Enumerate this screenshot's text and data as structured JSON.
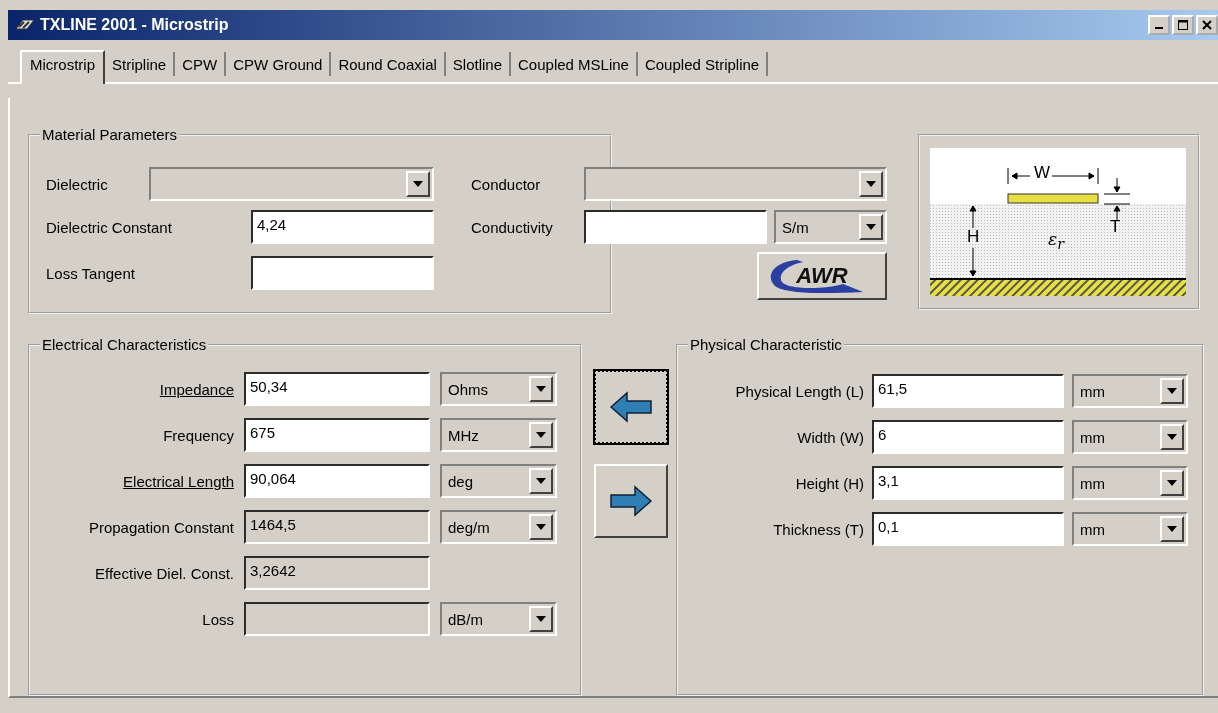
{
  "window": {
    "title": "TXLINE 2001 - Microstrip"
  },
  "tabs": [
    {
      "label": "Microstrip",
      "selected": true
    },
    {
      "label": "Stripline",
      "selected": false
    },
    {
      "label": "CPW",
      "selected": false
    },
    {
      "label": "CPW Ground",
      "selected": false
    },
    {
      "label": "Round Coaxial",
      "selected": false
    },
    {
      "label": "Slotline",
      "selected": false
    },
    {
      "label": "Coupled MSLine",
      "selected": false
    },
    {
      "label": "Coupled Stripline",
      "selected": false
    }
  ],
  "material": {
    "title": "Material Parameters",
    "dielectric": {
      "label": "Dielectric"
    },
    "dielectric_constant": {
      "label": "Dielectric Constant",
      "value": "4,24"
    },
    "loss_tangent": {
      "label": "Loss Tangent"
    },
    "conductor": {
      "label": "Conductor"
    },
    "conductivity": {
      "label": "Conductivity",
      "unit": "S/m"
    },
    "logo_button": "AWR"
  },
  "diagram": {
    "width": "W",
    "height": "H",
    "thickness": "T",
    "permittivity": "ε$_{r}$"
  },
  "electrical": {
    "title": "Electrical Characteristics",
    "rows": [
      {
        "label": "Impedance",
        "underlined": true,
        "editable": true,
        "value": "50,34",
        "unit": "Ohms"
      },
      {
        "label": "Frequency",
        "underlined": false,
        "editable": true,
        "value": "675",
        "unit": "MHz"
      },
      {
        "label": "Electrical Length",
        "underlined": true,
        "editable": true,
        "value": "90,064",
        "unit": "deg"
      },
      {
        "label": "Propagation Constant",
        "underlined": false,
        "editable": false,
        "value": "1464,5",
        "unit": "deg/m"
      },
      {
        "label": "Effective Diel. Const.",
        "underlined": false,
        "editable": false,
        "value": "3,2642"
      },
      {
        "label": "Loss",
        "underlined": false,
        "editable": false,
        "unit": "dB/m"
      }
    ]
  },
  "direction_buttons": [
    {
      "kind": "left",
      "selected": true
    },
    {
      "kind": "right",
      "selected": false
    }
  ],
  "physical": {
    "title": "Physical Characteristic",
    "rows": [
      {
        "label": "Physical Length (L)",
        "underlined": false,
        "editable": true,
        "value": "61,5",
        "unit": "mm"
      },
      {
        "label": "Width (W)",
        "underlined": false,
        "editable": true,
        "value": "6",
        "unit": "mm"
      },
      {
        "label": "Height (H)",
        "underlined": false,
        "editable": true,
        "value": "3,1",
        "unit": "mm"
      },
      {
        "label": "Thickness (T)",
        "underlined": false,
        "editable": true,
        "value": "0,1",
        "unit": "mm"
      }
    ]
  }
}
